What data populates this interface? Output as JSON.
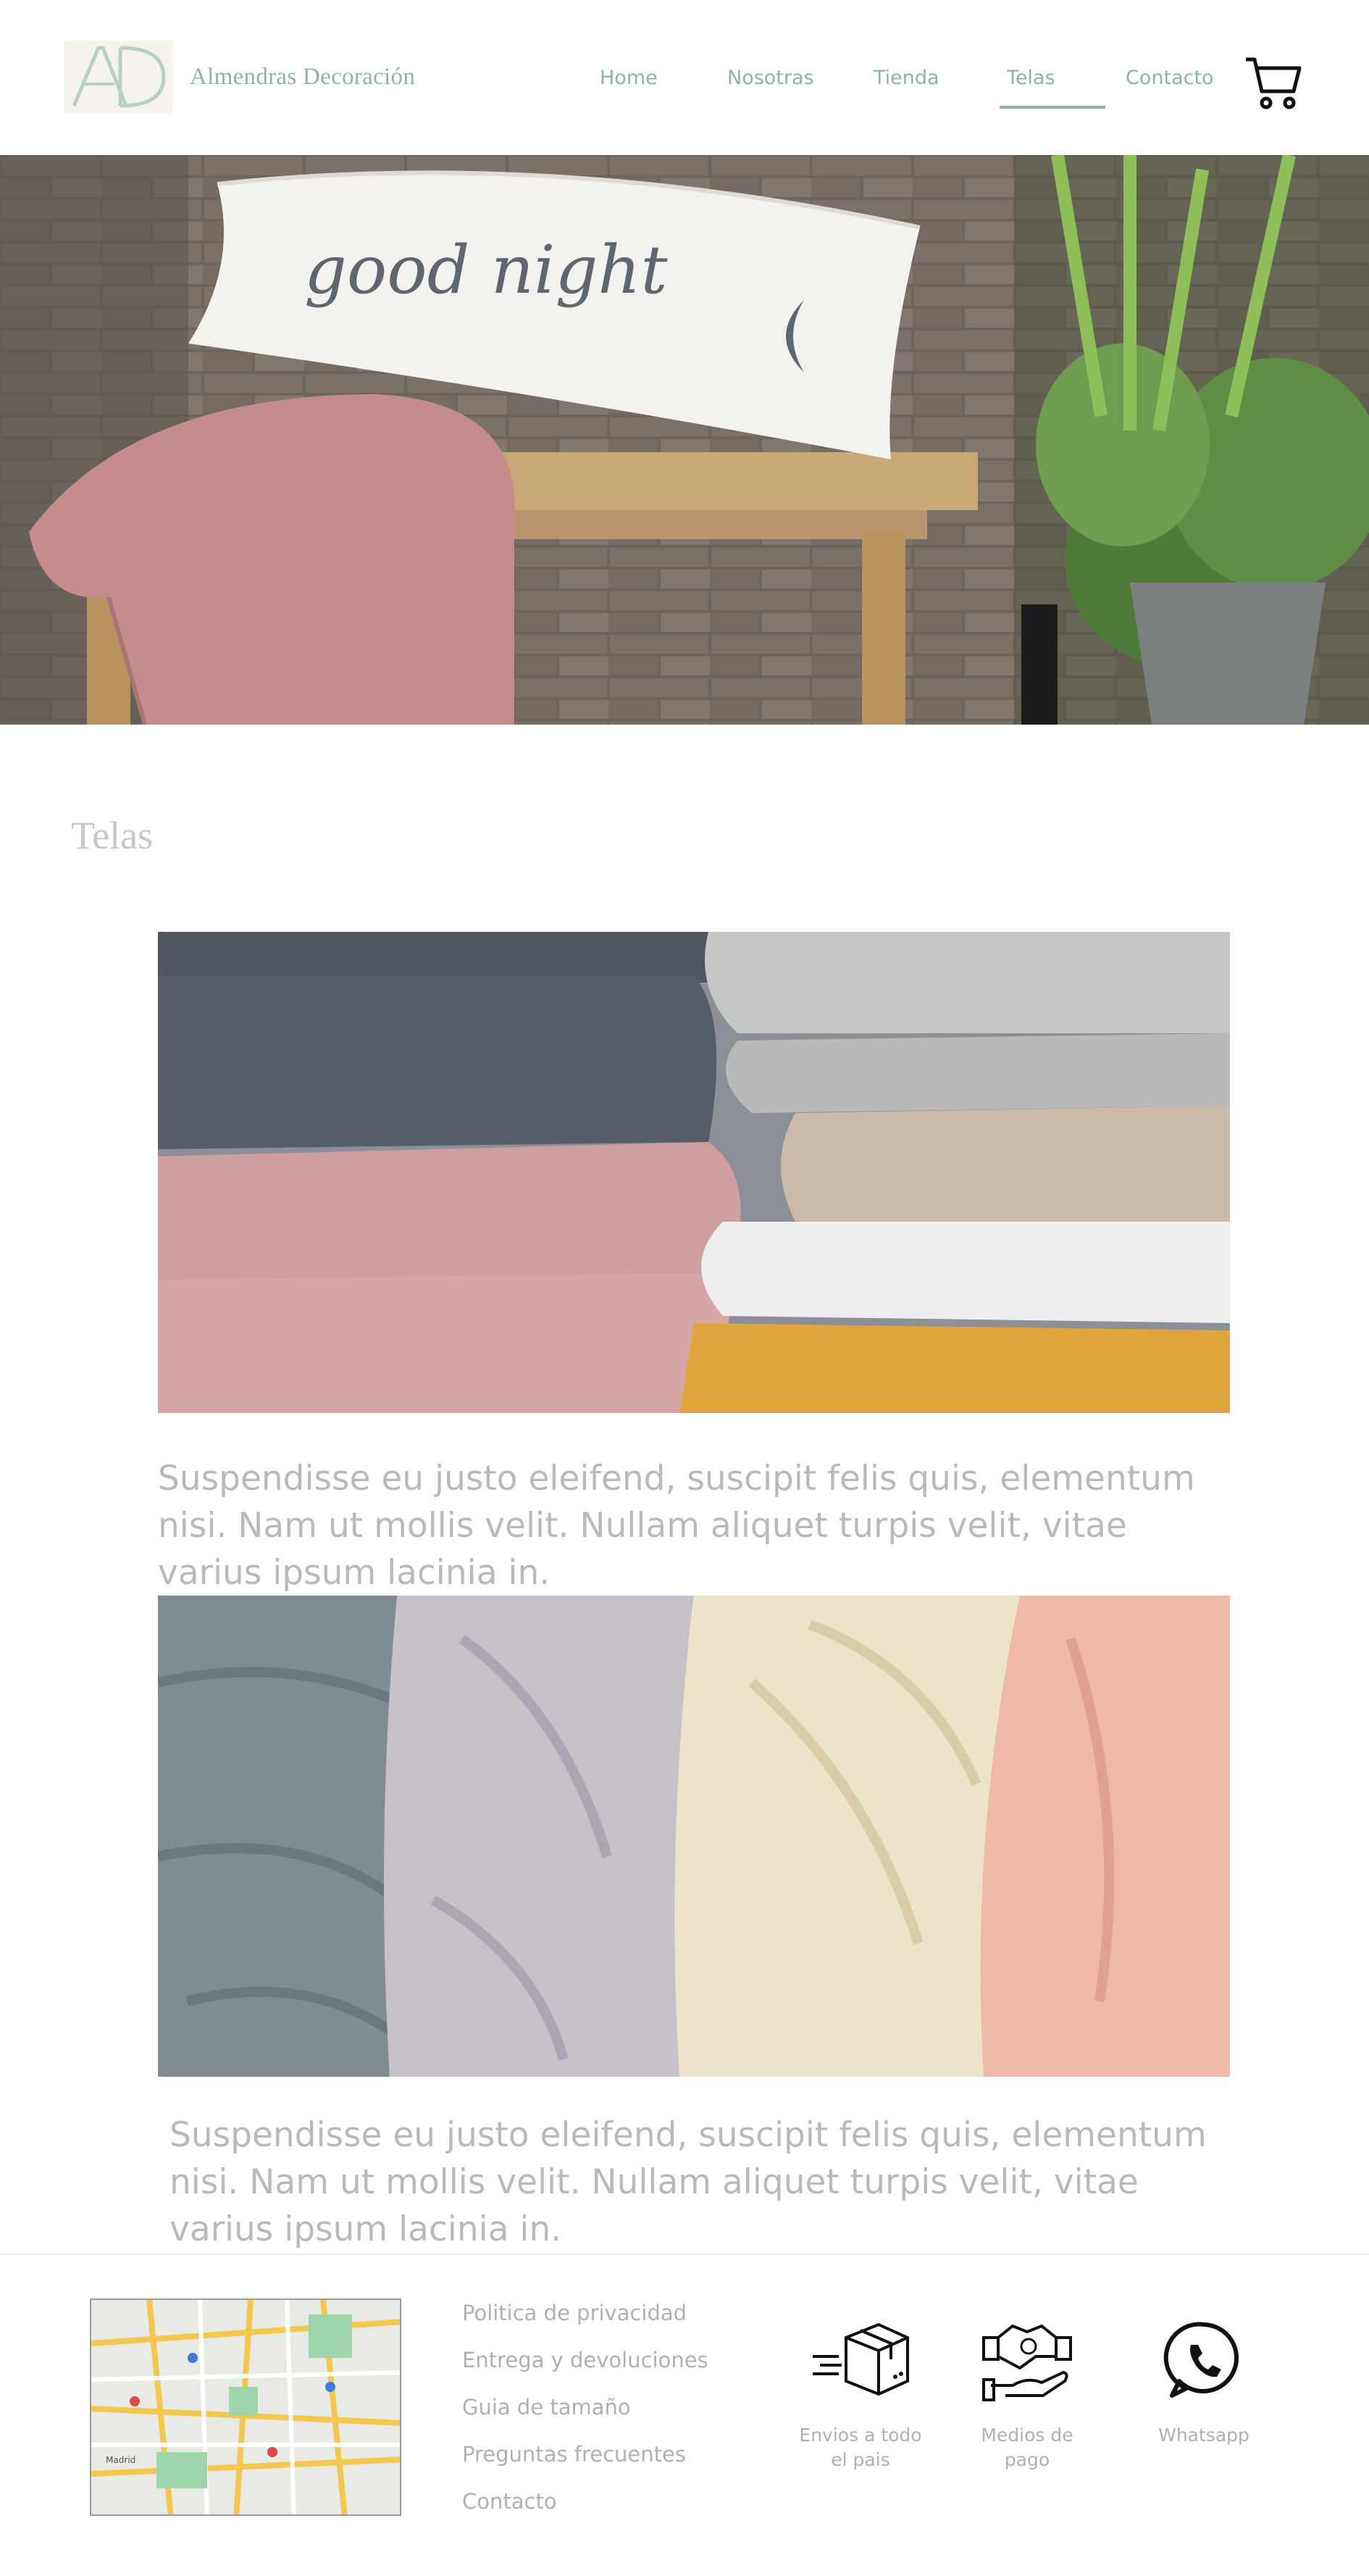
{
  "header": {
    "brand_name": "Almendras Decoración",
    "logo_letters": "AD",
    "nav": [
      {
        "label": "Home"
      },
      {
        "label": "Nosotras"
      },
      {
        "label": "Tienda"
      },
      {
        "label": "Telas"
      },
      {
        "label": "Contacto"
      }
    ],
    "active_nav": "Telas",
    "cart_icon": "shopping-cart-icon"
  },
  "hero": {
    "pillow_text": "good night"
  },
  "main": {
    "title": "Telas",
    "sections": [
      {
        "caption": "Suspendisse eu justo eleifend, suscipit felis quis, elementum nisi. Nam ut mollis velit. Nullam aliquet turpis velit, vitae varius ipsum lacinia in."
      },
      {
        "caption": "Suspendisse eu justo eleifend, suscipit felis quis, elementum nisi. Nam ut mollis velit. Nullam aliquet turpis velit, vitae varius ipsum lacinia in."
      }
    ]
  },
  "footer": {
    "links": [
      "Politica de privacidad",
      "Entrega y devoluciones",
      "Guia de tamaño",
      "Preguntas frecuentes",
      "Contacto"
    ],
    "features": [
      {
        "icon": "delivery-box-icon",
        "label_line1": "Envios a todo",
        "label_line2": "el pais"
      },
      {
        "icon": "payment-handshake-icon",
        "label_line1": "Medios de",
        "label_line2": "pago"
      },
      {
        "icon": "whatsapp-icon",
        "label_line1": "Whatsapp",
        "label_line2": ""
      }
    ],
    "map_labels": [
      "Madrid"
    ]
  },
  "colors": {
    "accent": "#8fb3a0",
    "text_muted": "#b9b9b9"
  }
}
